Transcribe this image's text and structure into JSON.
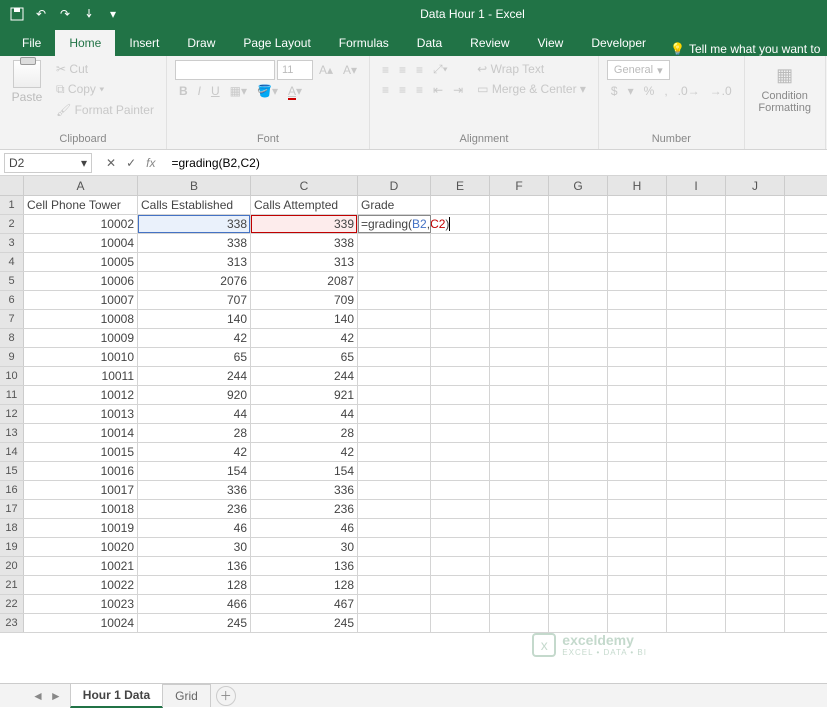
{
  "titlebar": {
    "title": "Data Hour 1 - Excel"
  },
  "tabs": {
    "file": "File",
    "home": "Home",
    "insert": "Insert",
    "draw": "Draw",
    "page_layout": "Page Layout",
    "formulas": "Formulas",
    "data": "Data",
    "review": "Review",
    "view": "View",
    "developer": "Developer",
    "tellme": "Tell me what you want to"
  },
  "ribbon": {
    "clipboard": {
      "label": "Clipboard",
      "paste": "Paste",
      "cut": "Cut",
      "copy": "Copy",
      "painter": "Format Painter"
    },
    "font": {
      "label": "Font",
      "size": "11",
      "bold": "B",
      "italic": "I",
      "underline": "U"
    },
    "alignment": {
      "label": "Alignment",
      "wrap": "Wrap Text",
      "merge": "Merge & Center"
    },
    "number": {
      "label": "Number",
      "format": "General",
      "currency": "$",
      "percent": "%",
      "comma": ","
    },
    "cond": {
      "label1": "Condition",
      "label2": "Formatting"
    }
  },
  "fx": {
    "namebox": "D2",
    "formula": "=grading(B2,C2)",
    "formula_prefix": "=grading(",
    "formula_ref1": "B2",
    "formula_sep": ",",
    "formula_ref2": "C2",
    "formula_suffix": ")"
  },
  "cols": [
    "A",
    "B",
    "C",
    "D",
    "E",
    "F",
    "G",
    "H",
    "I",
    "J"
  ],
  "headers": {
    "A": "Cell Phone Tower",
    "B": "Calls Established",
    "C": "Calls Attempted",
    "D": "Grade"
  },
  "rows": [
    {
      "n": 2,
      "A": "10002",
      "B": "338",
      "C": "339"
    },
    {
      "n": 3,
      "A": "10004",
      "B": "338",
      "C": "338"
    },
    {
      "n": 4,
      "A": "10005",
      "B": "313",
      "C": "313"
    },
    {
      "n": 5,
      "A": "10006",
      "B": "2076",
      "C": "2087"
    },
    {
      "n": 6,
      "A": "10007",
      "B": "707",
      "C": "709"
    },
    {
      "n": 7,
      "A": "10008",
      "B": "140",
      "C": "140"
    },
    {
      "n": 8,
      "A": "10009",
      "B": "42",
      "C": "42"
    },
    {
      "n": 9,
      "A": "10010",
      "B": "65",
      "C": "65"
    },
    {
      "n": 10,
      "A": "10011",
      "B": "244",
      "C": "244"
    },
    {
      "n": 11,
      "A": "10012",
      "B": "920",
      "C": "921"
    },
    {
      "n": 12,
      "A": "10013",
      "B": "44",
      "C": "44"
    },
    {
      "n": 13,
      "A": "10014",
      "B": "28",
      "C": "28"
    },
    {
      "n": 14,
      "A": "10015",
      "B": "42",
      "C": "42"
    },
    {
      "n": 15,
      "A": "10016",
      "B": "154",
      "C": "154"
    },
    {
      "n": 16,
      "A": "10017",
      "B": "336",
      "C": "336"
    },
    {
      "n": 17,
      "A": "10018",
      "B": "236",
      "C": "236"
    },
    {
      "n": 18,
      "A": "10019",
      "B": "46",
      "C": "46"
    },
    {
      "n": 19,
      "A": "10020",
      "B": "30",
      "C": "30"
    },
    {
      "n": 20,
      "A": "10021",
      "B": "136",
      "C": "136"
    },
    {
      "n": 21,
      "A": "10022",
      "B": "128",
      "C": "128"
    },
    {
      "n": 22,
      "A": "10023",
      "B": "466",
      "C": "467"
    },
    {
      "n": 23,
      "A": "10024",
      "B": "245",
      "C": "245"
    }
  ],
  "sheets": {
    "active": "Hour 1 Data",
    "other": "Grid"
  },
  "watermark": {
    "brand": "exceldemy",
    "tag": "EXCEL • DATA • BI"
  }
}
